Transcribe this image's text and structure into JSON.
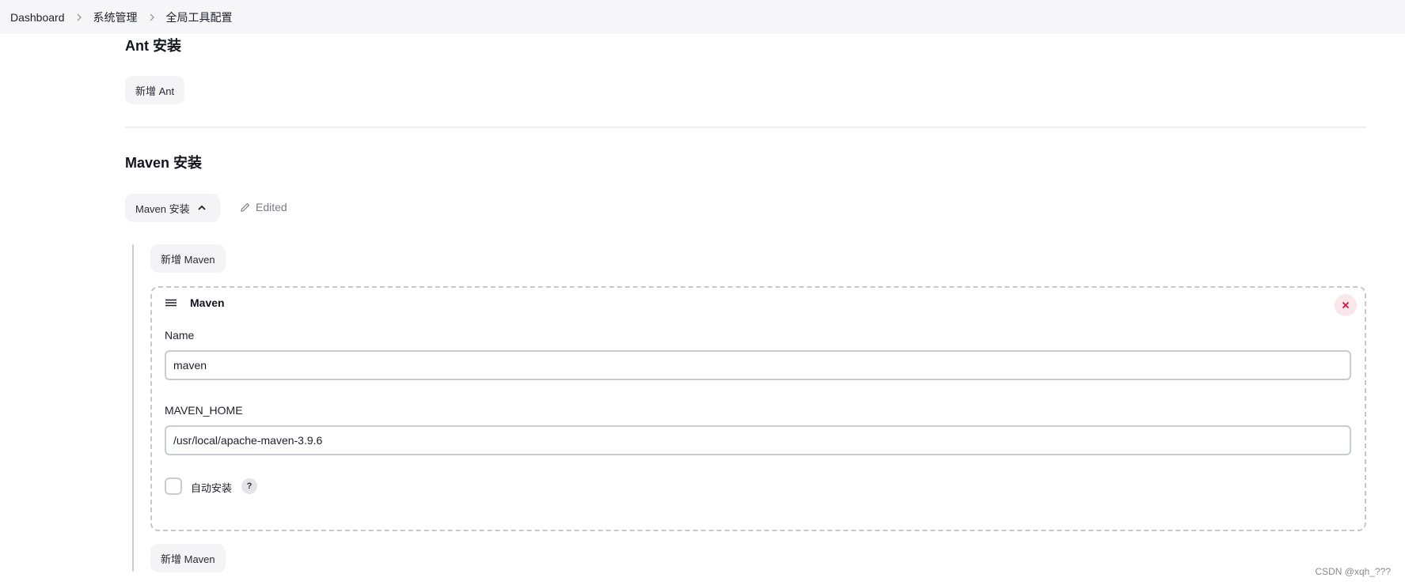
{
  "breadcrumb": {
    "items": [
      "Dashboard",
      "系统管理",
      "全局工具配置"
    ]
  },
  "ant_section": {
    "title": "Ant 安装",
    "add_button": "新增 Ant"
  },
  "maven_section": {
    "title": "Maven 安装",
    "dropdown_label": "Maven 安装",
    "edited_label": "Edited",
    "add_button_top": "新增 Maven",
    "add_button_bottom": "新增 Maven",
    "installation": {
      "title": "Maven",
      "name_label": "Name",
      "name_value": "maven",
      "home_label": "MAVEN_HOME",
      "home_value": "/usr/local/apache-maven-3.9.6",
      "auto_install_label": "自动安装",
      "auto_install_checked": false,
      "help_glyph": "?"
    }
  },
  "watermark": "CSDN @xqh_???",
  "colors": {
    "topbar_bg": "#f6f6f8",
    "button_bg": "#f4f4f7",
    "close_bg": "#fbe6ea",
    "close_fg": "#d0103a",
    "border": "#c8ccd0"
  }
}
